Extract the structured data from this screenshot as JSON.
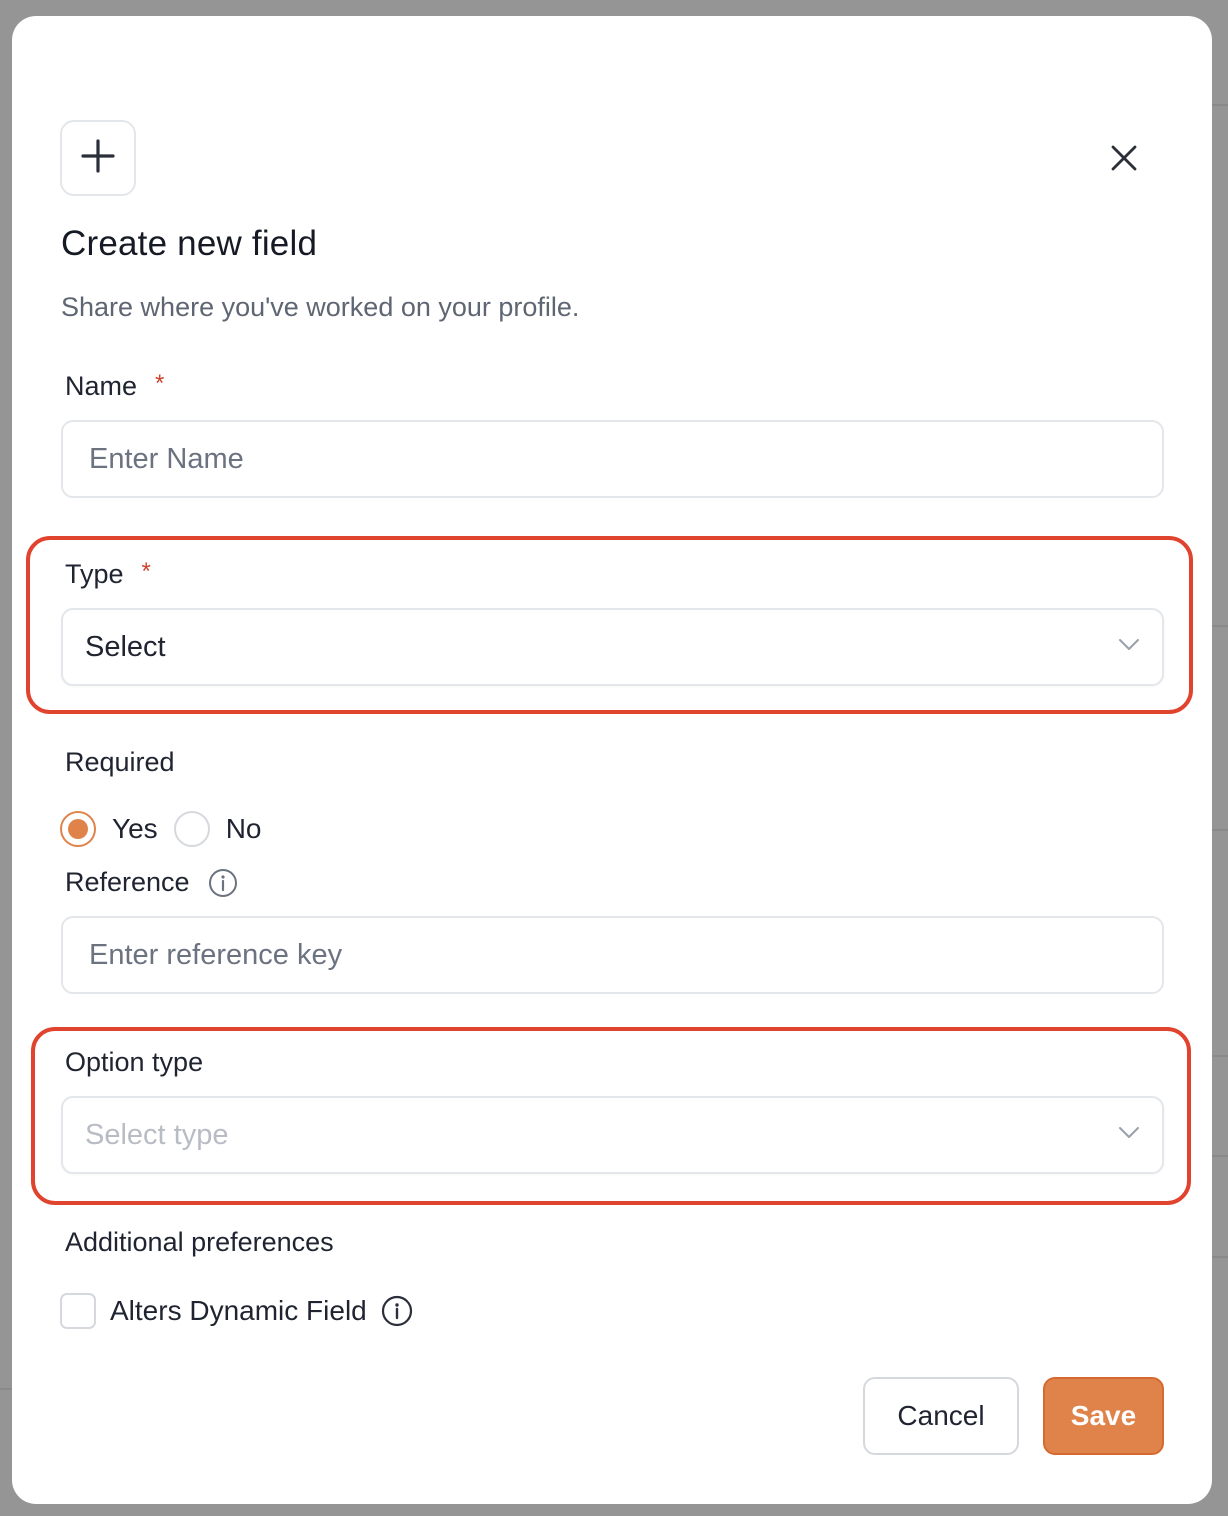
{
  "modal": {
    "title": "Create new field",
    "subtitle": "Share where you've worked on your profile.",
    "header_icon": "plus-icon",
    "close_icon": "close-icon"
  },
  "form": {
    "name": {
      "label": "Name",
      "required_mark": "*",
      "placeholder": "Enter Name",
      "value": ""
    },
    "type": {
      "label": "Type",
      "required_mark": "*",
      "value": "Select"
    },
    "required": {
      "label": "Required",
      "options": [
        {
          "label": "Yes",
          "checked": true
        },
        {
          "label": "No",
          "checked": false
        }
      ]
    },
    "reference": {
      "label": "Reference",
      "placeholder": "Enter reference key",
      "value": ""
    },
    "option_type": {
      "label": "Option type",
      "placeholder": "Select type"
    },
    "additional": {
      "label": "Additional preferences",
      "checkbox_label": "Alters Dynamic Field",
      "checked": false
    }
  },
  "buttons": {
    "cancel": "Cancel",
    "save": "Save"
  },
  "colors": {
    "accent": "#e0834a",
    "required_mark": "#d0432a",
    "highlight_border": "#e0432e"
  }
}
